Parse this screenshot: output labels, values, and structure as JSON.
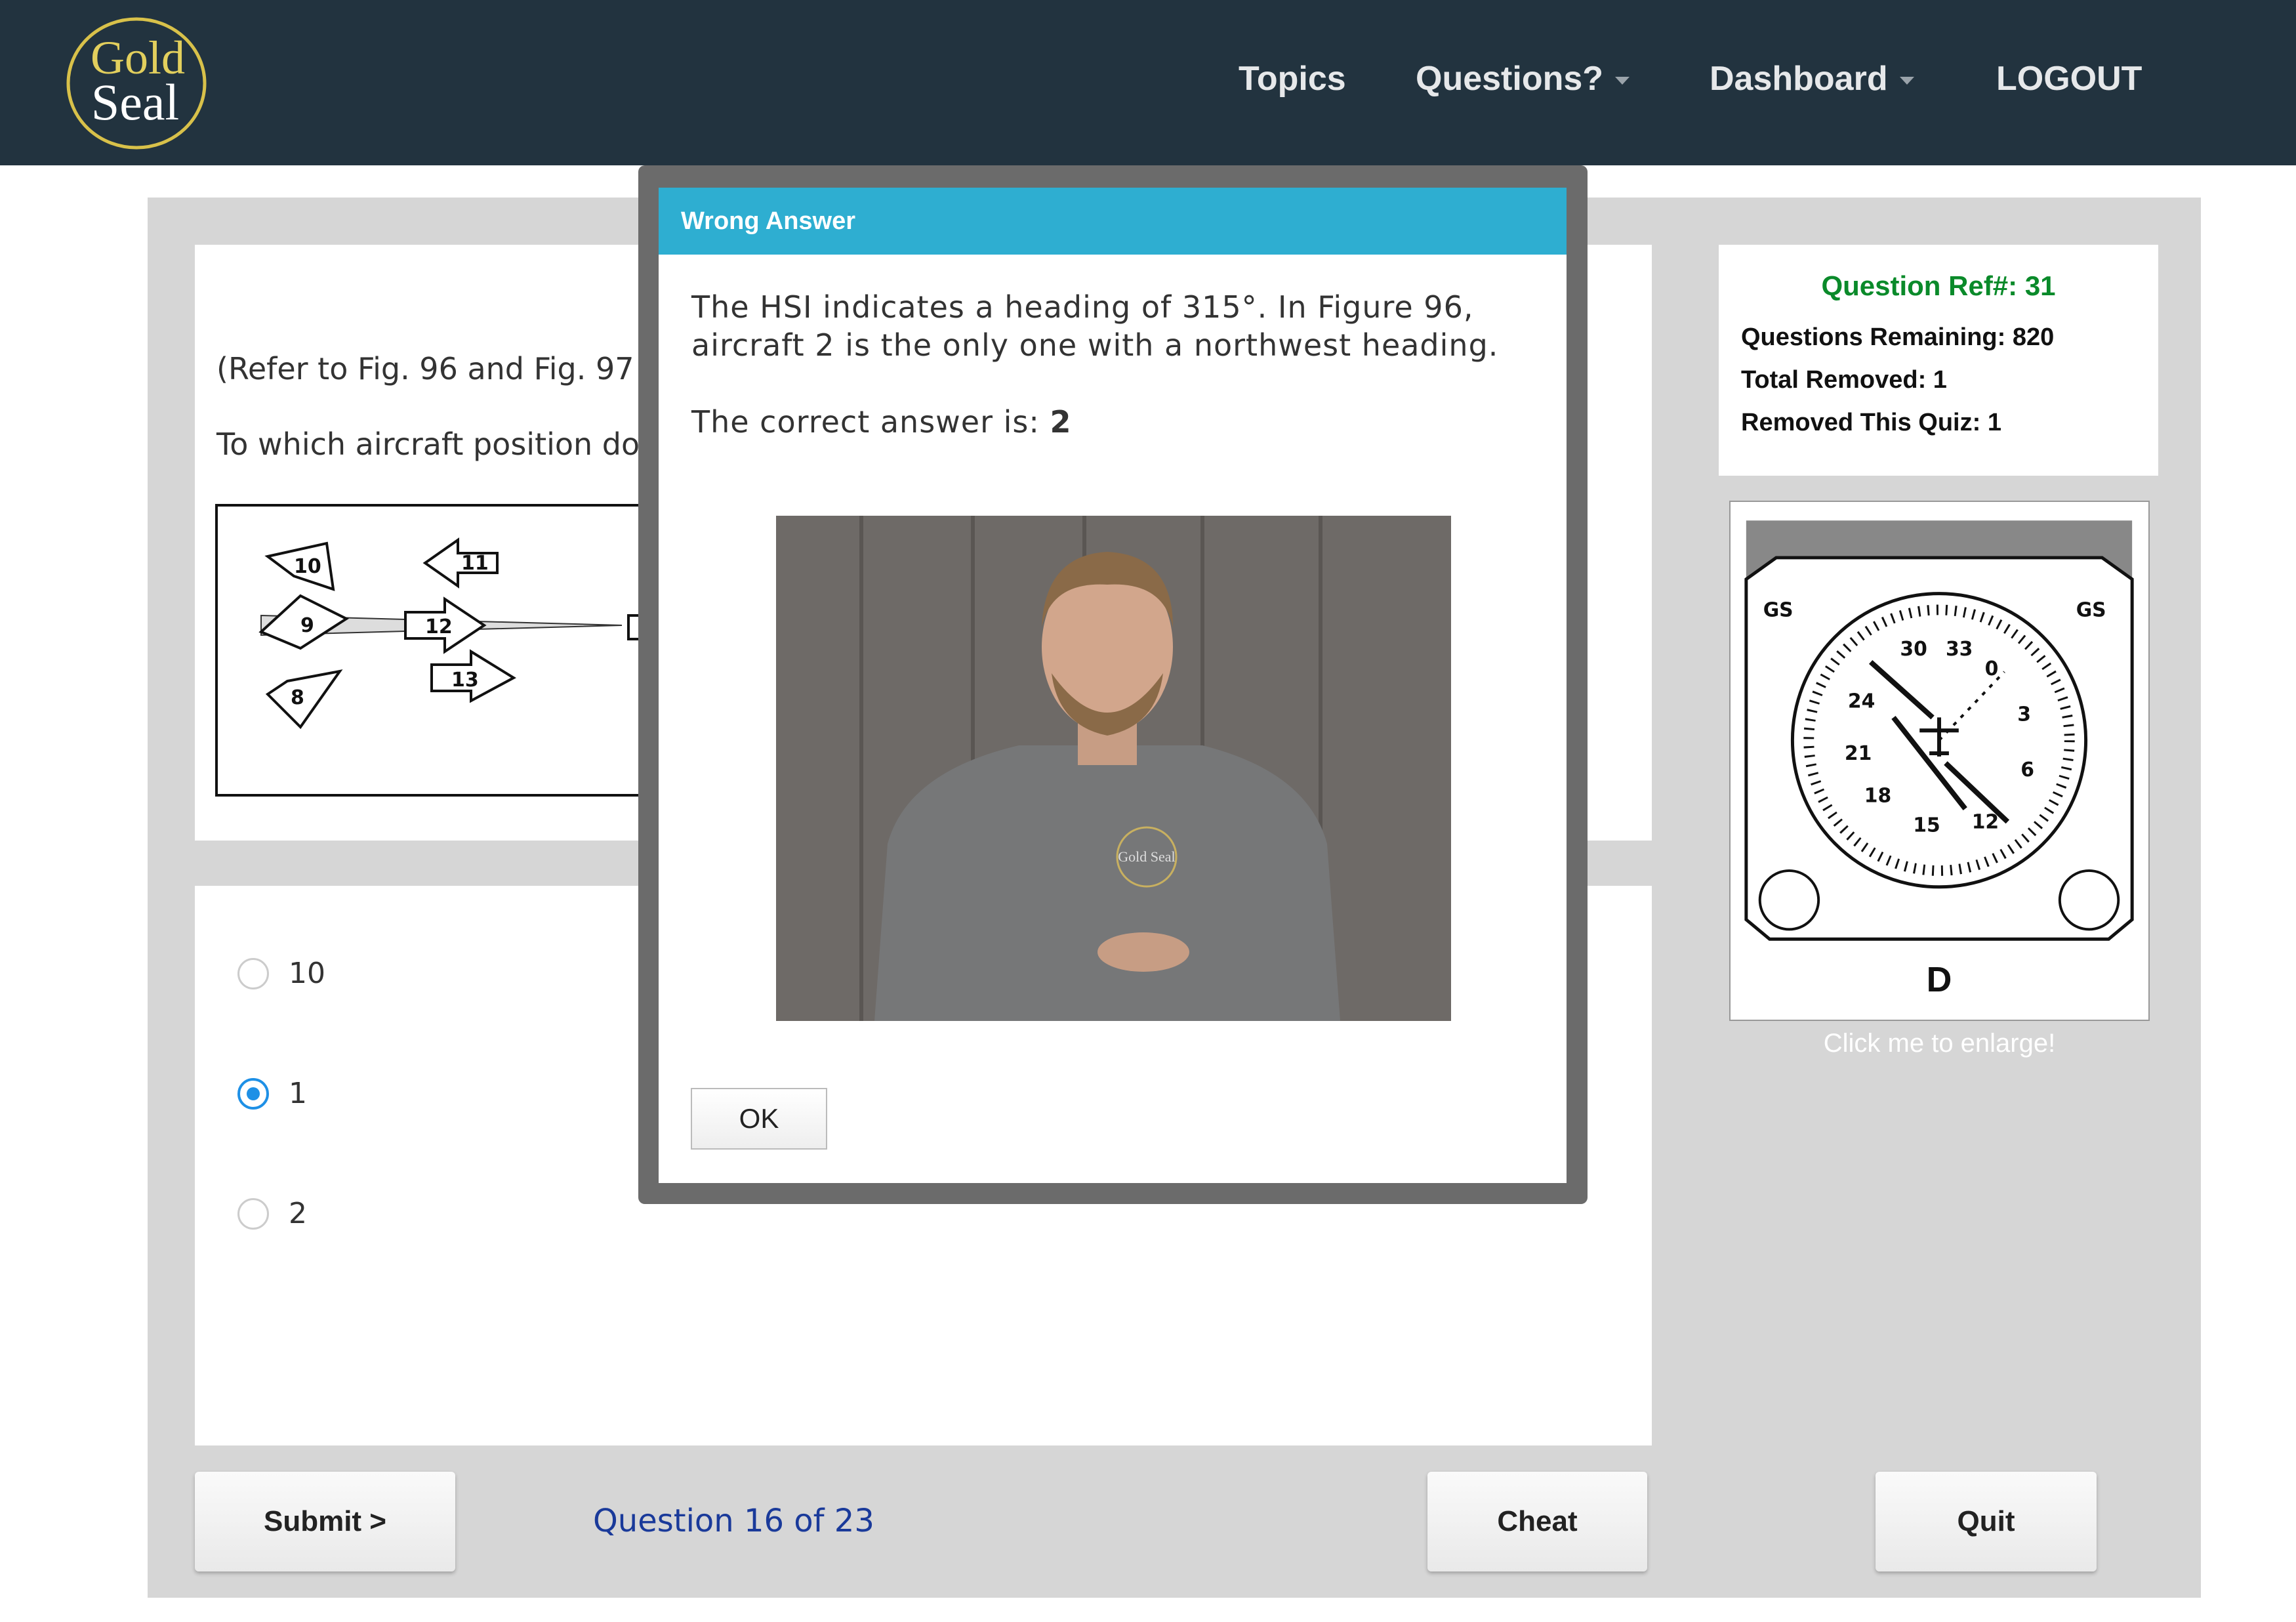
{
  "header": {
    "logo_text": [
      "Gold",
      "Seal"
    ],
    "nav": [
      {
        "label": "Topics"
      },
      {
        "label": "Questions?"
      },
      {
        "label": "Dashboard"
      },
      {
        "label": "LOGOUT"
      }
    ]
  },
  "question": {
    "line1": "(Refer to Fig. 96 and Fig. 97",
    "line2": "To which aircraft position do",
    "figure_labels": [
      "10",
      "9",
      "11",
      "12",
      "13",
      "8",
      "9"
    ]
  },
  "answers": [
    {
      "label": "10",
      "selected": false
    },
    {
      "label": "1",
      "selected": true
    },
    {
      "label": "2",
      "selected": false
    }
  ],
  "info": {
    "ref": "Question Ref#: 31",
    "remaining": "Questions Remaining: 820",
    "total_removed": "Total Removed: 1",
    "removed_quiz": "Removed This Quiz: 1"
  },
  "figure": {
    "letter": "D",
    "gs_left": "GS",
    "gs_right": "GS",
    "dial": [
      "30",
      "33",
      "0",
      "3",
      "6",
      "12",
      "15",
      "18",
      "21",
      "24"
    ],
    "enlarge": "Click me to enlarge!"
  },
  "footer": {
    "submit": "Submit >",
    "progress": "Question 16 of 23",
    "cheat": "Cheat",
    "quit": "Quit"
  },
  "modal": {
    "title": "Wrong Answer",
    "line1": "The HSI indicates a heading of 315°. In Figure 96,",
    "line2": "aircraft 2 is the only one with a northwest heading.",
    "answer_prefix": "The correct answer is:",
    "answer": "2",
    "ok": "OK",
    "video_logo": "Gold Seal"
  },
  "colors": {
    "header": "#22333f",
    "modal_header": "#2eaed1",
    "ref_green": "#0a8a2a",
    "progress_blue": "#1a3a9a",
    "radio_selected": "#1e90e6"
  }
}
